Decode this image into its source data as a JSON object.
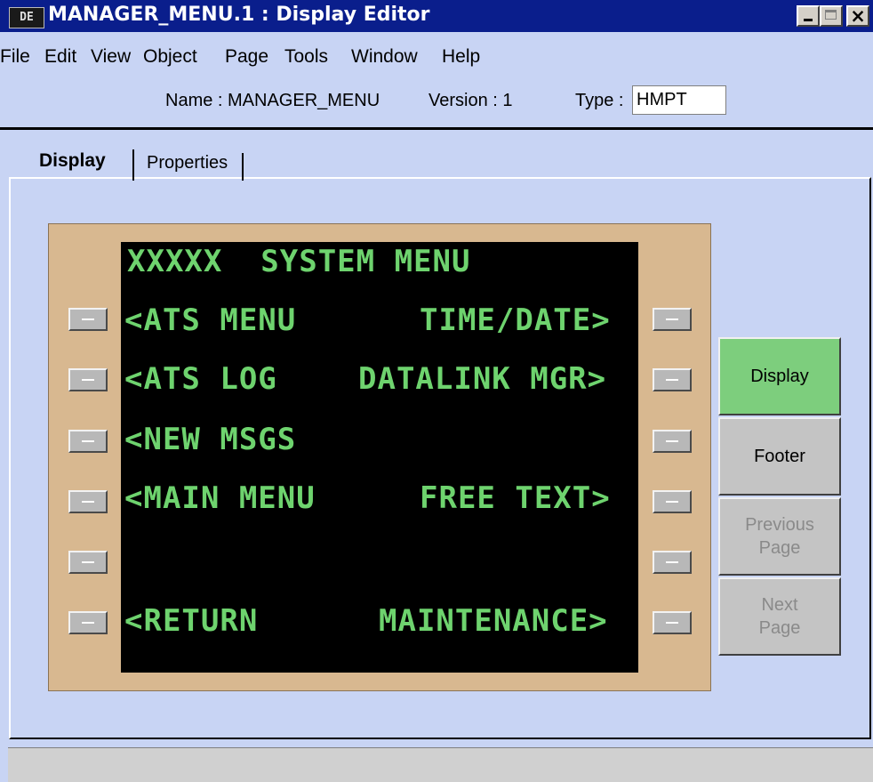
{
  "window": {
    "app_icon_text": "DE",
    "title": "MANAGER_MENU.1 : Display Editor"
  },
  "menu": [
    "File",
    "Edit",
    "View",
    "Object",
    "Page",
    "Tools",
    "Window",
    "Help"
  ],
  "info": {
    "name": "Name : MANAGER_MENU",
    "version": "Version : 1",
    "type_label": "Type :",
    "type_value": "HMPT"
  },
  "tabs": {
    "display": "Display",
    "properties": "Properties"
  },
  "screen": {
    "title": "XXXXX  SYSTEM MENU",
    "lines": {
      "l1_left": "<ATS MENU",
      "l1_right": "TIME/DATE>",
      "l2_left": "<ATS LOG",
      "l2_right": "DATALINK MGR>",
      "l3_left": "<NEW MSGS",
      "l4_left": "<MAIN MENU",
      "l4_right": "FREE TEXT>",
      "l6_left": "<RETURN",
      "l6_right": "MAINTENANCE>"
    },
    "text_color": "#6ed36e"
  },
  "side_buttons": {
    "display": "Display",
    "footer": "Footer",
    "previous_page": "Previous\nPage",
    "next_page": "Next\nPage"
  },
  "colors": {
    "title_bar": "#0a1e8c",
    "background": "#c8d4f4",
    "bezel": "#d8b890",
    "active_button": "#7dce7d"
  }
}
